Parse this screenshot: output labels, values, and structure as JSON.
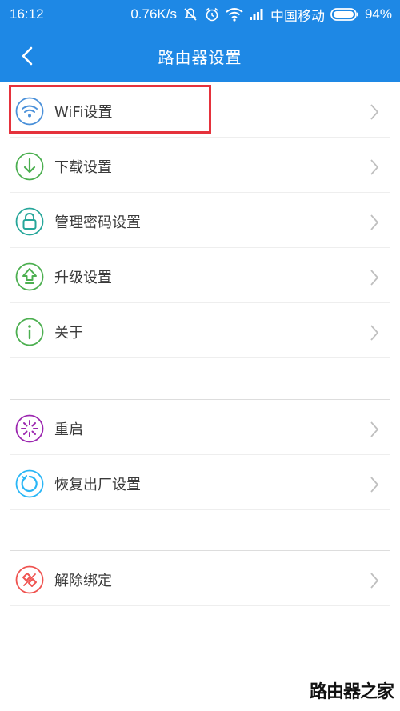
{
  "status_bar": {
    "time": "16:12",
    "speed": "0.76K/s",
    "carrier": "中国移动",
    "battery": "94%",
    "icons": [
      "mute-icon",
      "alarm-icon",
      "wifi-signal-icon",
      "cell-signal-icon",
      "battery-icon"
    ]
  },
  "nav": {
    "title": "路由器设置",
    "back_icon": "back-chevron-icon"
  },
  "colors": {
    "primary": "#1e88e5",
    "highlight": "#e5323c",
    "wifi": "#4a90d9",
    "download": "#4caf50",
    "password": "#26a69a",
    "upgrade": "#4caf50",
    "about": "#4caf50",
    "reboot": "#9c27b0",
    "reset": "#29b6f6",
    "unbind": "#ef5350"
  },
  "menu": {
    "group1": [
      {
        "label": "WiFi设置",
        "icon": "wifi-icon"
      },
      {
        "label": "下载设置",
        "icon": "download-icon"
      },
      {
        "label": "管理密码设置",
        "icon": "lock-icon"
      },
      {
        "label": "升级设置",
        "icon": "upgrade-icon"
      },
      {
        "label": "关于",
        "icon": "info-icon"
      }
    ],
    "group2": [
      {
        "label": "重启",
        "icon": "restart-icon"
      },
      {
        "label": "恢复出厂设置",
        "icon": "reset-icon"
      }
    ],
    "group3": [
      {
        "label": "解除绑定",
        "icon": "unbind-icon"
      }
    ]
  },
  "watermark": "路由器之家"
}
